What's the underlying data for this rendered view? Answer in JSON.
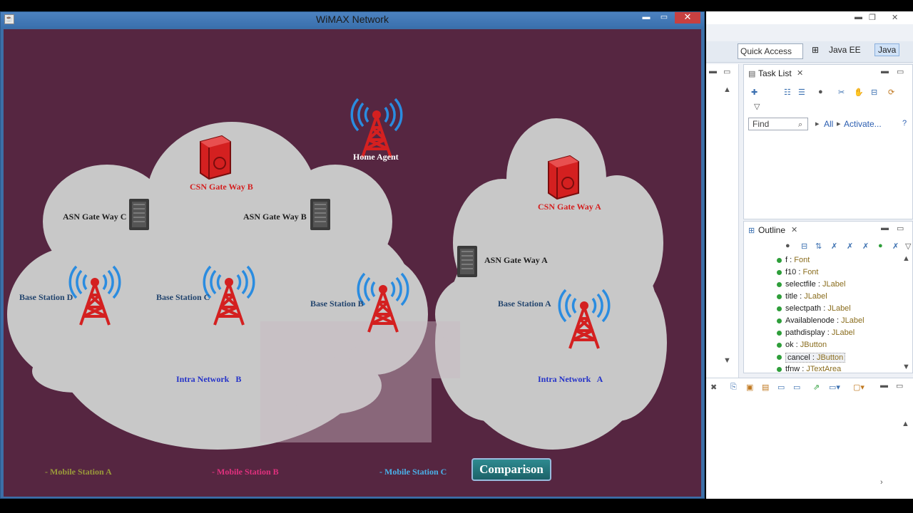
{
  "window": {
    "title": "WiMAX Network",
    "close_glyph": "✕",
    "min_glyph": "▬",
    "max_glyph": "▭"
  },
  "network": {
    "home_agent": "Home Agent",
    "csn_b": "CSN Gate Way B",
    "csn_a": "CSN Gate Way A",
    "asn_c": "ASN Gate Way C",
    "asn_b": "ASN Gate Way B",
    "asn_a": "ASN Gate Way A",
    "bs_d": "Base Station D",
    "bs_c": "Base Station C",
    "bs_b": "Base Station B",
    "bs_a": "Base Station A",
    "intra_b": "Intra Network   B",
    "intra_a": "Intra Network   A"
  },
  "mobile_stations": [
    {
      "label": "- Mobile Station A",
      "color": "#9a9a3a"
    },
    {
      "label": "- Mobile Station B",
      "color": "#e0307e"
    },
    {
      "label": "- Mobile Station C",
      "color": "#4ab0e8"
    }
  ],
  "comparison_button": "Comparison",
  "colors": {
    "background": "#562641",
    "cloud": "#c8c8c8",
    "tower": "#d42020",
    "signal": "#2a8ce0"
  },
  "eclipse": {
    "quick_access": "Quick Access",
    "perspective_javaee": "Java EE",
    "perspective_java": "Java",
    "task_list_title": "Task List",
    "find_placeholder": "Find",
    "filter_all": "All",
    "filter_activate": "Activate...",
    "outline_title": "Outline",
    "outline_items": [
      {
        "name": "f",
        "type": "Font"
      },
      {
        "name": "f10",
        "type": "Font"
      },
      {
        "name": "selectfile",
        "type": "JLabel"
      },
      {
        "name": "title",
        "type": "JLabel"
      },
      {
        "name": "selectpath",
        "type": "JLabel"
      },
      {
        "name": "Availablenode",
        "type": "JLabel"
      },
      {
        "name": "pathdisplay",
        "type": "JLabel"
      },
      {
        "name": "ok",
        "type": "JButton"
      },
      {
        "name": "cancel",
        "type": "JButton"
      },
      {
        "name": "tfnw",
        "type": "JTextArea"
      }
    ]
  }
}
